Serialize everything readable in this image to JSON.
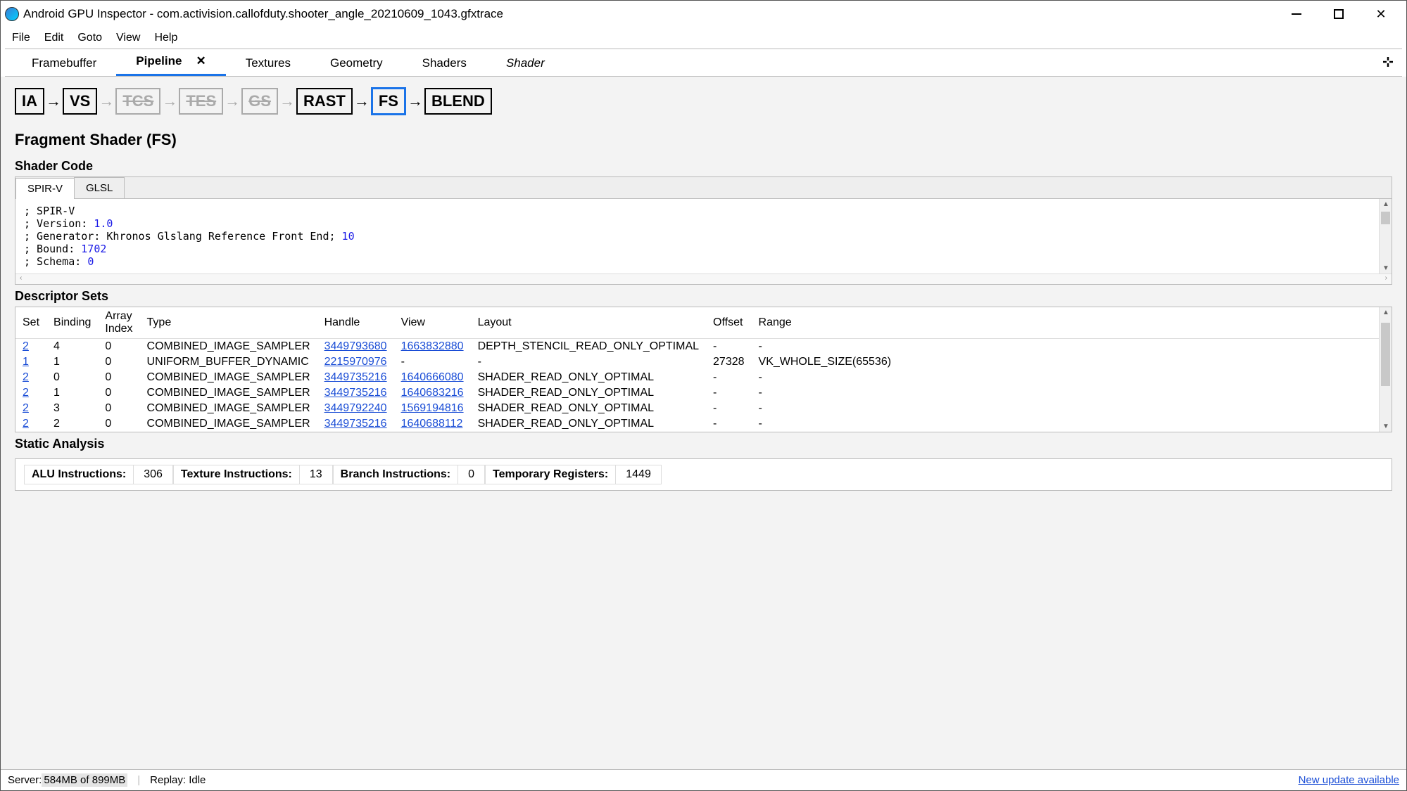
{
  "titlebar": {
    "title": "Android GPU Inspector - com.activision.callofduty.shooter_angle_20210609_1043.gfxtrace"
  },
  "menus": [
    "File",
    "Edit",
    "Goto",
    "View",
    "Help"
  ],
  "tabs": [
    "Framebuffer",
    "Pipeline",
    "Textures",
    "Geometry",
    "Shaders",
    "Shader"
  ],
  "tabs_active_index": 1,
  "pipeline_stages": [
    {
      "label": "IA",
      "enabled": true,
      "selected": false
    },
    {
      "label": "VS",
      "enabled": true,
      "selected": false
    },
    {
      "label": "TCS",
      "enabled": false,
      "selected": false
    },
    {
      "label": "TES",
      "enabled": false,
      "selected": false
    },
    {
      "label": "GS",
      "enabled": false,
      "selected": false
    },
    {
      "label": "RAST",
      "enabled": true,
      "selected": false
    },
    {
      "label": "FS",
      "enabled": true,
      "selected": true
    },
    {
      "label": "BLEND",
      "enabled": true,
      "selected": false
    }
  ],
  "page_heading": "Fragment Shader (FS)",
  "shader_code": {
    "heading": "Shader Code",
    "tabs": [
      "SPIR-V",
      "GLSL"
    ],
    "active_tab": 0,
    "lines": [
      {
        "prefix": "; SPIR-V",
        "num": ""
      },
      {
        "prefix": "; Version: ",
        "num": "1.0"
      },
      {
        "prefix": "; Generator: Khronos Glslang Reference Front End; ",
        "num": "10"
      },
      {
        "prefix": "; Bound: ",
        "num": "1702"
      },
      {
        "prefix": "; Schema: ",
        "num": "0"
      }
    ]
  },
  "descriptor_sets": {
    "heading": "Descriptor Sets",
    "columns": [
      "Set",
      "Binding",
      "Array Index",
      "Type",
      "Handle",
      "View",
      "Layout",
      "Offset",
      "Range"
    ],
    "rows": [
      {
        "set": "2",
        "binding": "4",
        "array_index": "0",
        "type": "COMBINED_IMAGE_SAMPLER",
        "handle": "3449793680",
        "view": "1663832880",
        "layout": "DEPTH_STENCIL_READ_ONLY_OPTIMAL",
        "offset": "-",
        "range": "-"
      },
      {
        "set": "1",
        "binding": "1",
        "array_index": "0",
        "type": "UNIFORM_BUFFER_DYNAMIC",
        "handle": "2215970976",
        "view": "-",
        "layout": "-",
        "offset": "27328",
        "range": "VK_WHOLE_SIZE(65536)"
      },
      {
        "set": "2",
        "binding": "0",
        "array_index": "0",
        "type": "COMBINED_IMAGE_SAMPLER",
        "handle": "3449735216",
        "view": "1640666080",
        "layout": "SHADER_READ_ONLY_OPTIMAL",
        "offset": "-",
        "range": "-"
      },
      {
        "set": "2",
        "binding": "1",
        "array_index": "0",
        "type": "COMBINED_IMAGE_SAMPLER",
        "handle": "3449735216",
        "view": "1640683216",
        "layout": "SHADER_READ_ONLY_OPTIMAL",
        "offset": "-",
        "range": "-"
      },
      {
        "set": "2",
        "binding": "3",
        "array_index": "0",
        "type": "COMBINED_IMAGE_SAMPLER",
        "handle": "3449792240",
        "view": "1569194816",
        "layout": "SHADER_READ_ONLY_OPTIMAL",
        "offset": "-",
        "range": "-"
      },
      {
        "set": "2",
        "binding": "2",
        "array_index": "0",
        "type": "COMBINED_IMAGE_SAMPLER",
        "handle": "3449735216",
        "view": "1640688112",
        "layout": "SHADER_READ_ONLY_OPTIMAL",
        "offset": "-",
        "range": "-"
      }
    ]
  },
  "static_analysis": {
    "heading": "Static Analysis",
    "items": [
      {
        "label": "ALU Instructions:",
        "value": "306"
      },
      {
        "label": "Texture Instructions:",
        "value": "13"
      },
      {
        "label": "Branch Instructions:",
        "value": "0"
      },
      {
        "label": "Temporary Registers:",
        "value": "1449"
      }
    ]
  },
  "statusbar": {
    "server_label": "Server: ",
    "server_value": "584MB of 899MB",
    "replay": "Replay:  Idle",
    "update": "New update available"
  }
}
